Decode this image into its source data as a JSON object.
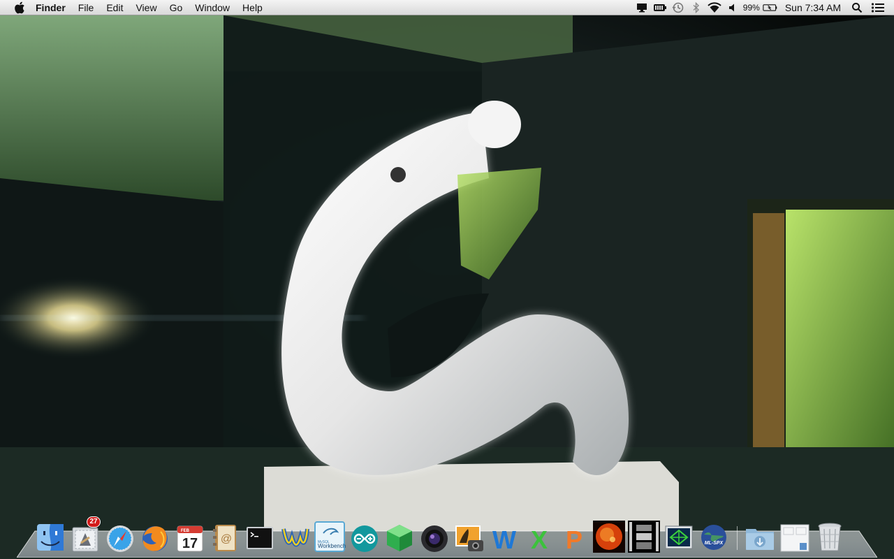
{
  "menubar": {
    "apple_icon": "apple-icon",
    "app_name": "Finder",
    "menus": [
      "File",
      "Edit",
      "View",
      "Go",
      "Window",
      "Help"
    ],
    "status": {
      "display_icon": "display-mirroring-icon",
      "battery_menu_icon": "battery-extra-icon",
      "time_machine_icon": "time-machine-icon",
      "bluetooth_icon": "bluetooth-icon",
      "wifi_icon": "wifi-icon",
      "volume_icon": "volume-icon",
      "battery_percent": "99%",
      "clock": "Sun 7:34 AM",
      "spotlight_icon": "spotlight-search-icon",
      "notification_icon": "notification-center-icon"
    }
  },
  "dock": {
    "apps": [
      {
        "name": "finder-icon"
      },
      {
        "name": "mail-icon",
        "badge": "27"
      },
      {
        "name": "safari-icon"
      },
      {
        "name": "firefox-icon"
      },
      {
        "name": "calendar-icon",
        "month": "FEB",
        "day": "17"
      },
      {
        "name": "address-book-icon"
      },
      {
        "name": "terminal-icon"
      },
      {
        "name": "wireshark-icon"
      },
      {
        "name": "mysql-workbench-icon",
        "label_top": "MySQL",
        "label_bottom": "Workbench"
      },
      {
        "name": "arduino-icon"
      },
      {
        "name": "green-cube-icon"
      },
      {
        "name": "camera-lens-icon"
      },
      {
        "name": "iphoto-icon"
      },
      {
        "name": "word-icon",
        "letter": "W"
      },
      {
        "name": "excel-icon",
        "letter": "X"
      },
      {
        "name": "powerpoint-icon",
        "letter": "P"
      },
      {
        "name": "sun-image-icon"
      },
      {
        "name": "filmstrip-icon"
      },
      {
        "name": "network-monitor-icon"
      },
      {
        "name": "globe-app-icon",
        "label": "ML-SPX"
      }
    ],
    "stacks": [
      {
        "name": "downloads-folder-icon"
      },
      {
        "name": "documents-stack-icon"
      },
      {
        "name": "trash-icon"
      }
    ]
  },
  "colors": {
    "menubar_bg": "#e4e4e4",
    "badge_red": "#d31b1b",
    "word_blue": "#1e78d6",
    "excel_green": "#3cc23c",
    "powerpoint_orange": "#f07a2a"
  }
}
